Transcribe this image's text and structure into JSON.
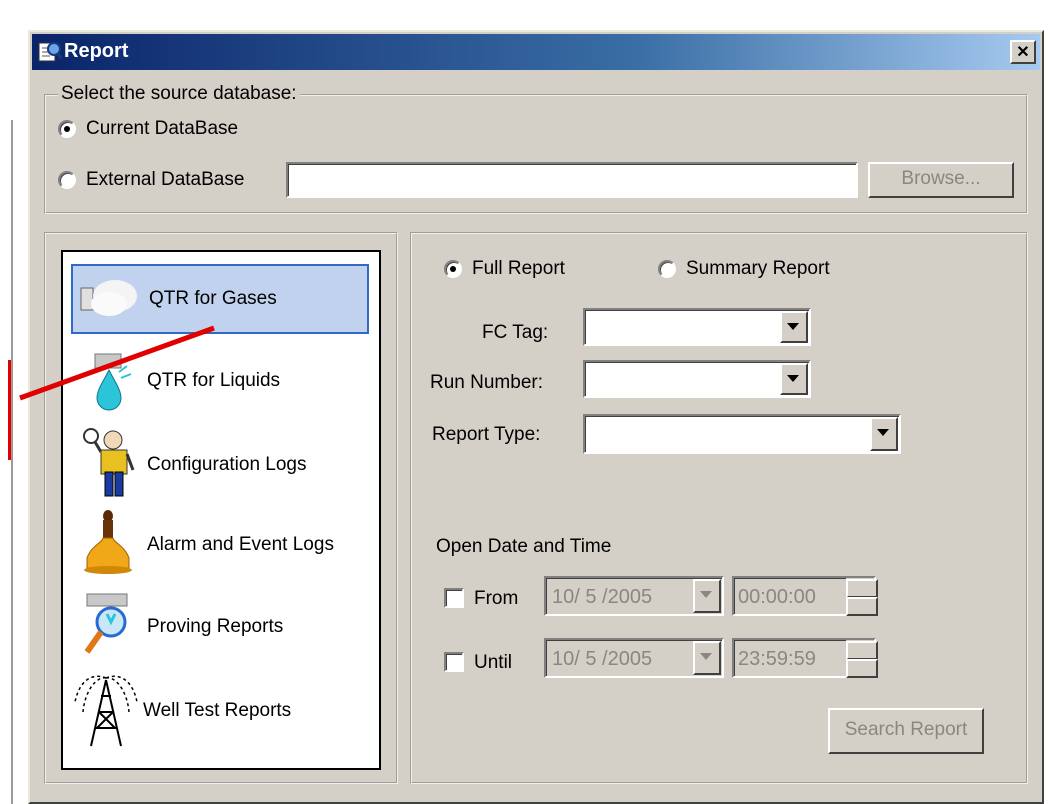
{
  "dialog": {
    "title": "Report",
    "close_label": "✕"
  },
  "source": {
    "group_label": "Select the source database:",
    "current_label": "Current DataBase",
    "external_label": "External DataBase",
    "external_path": "",
    "browse_label": "Browse...",
    "selected": "current"
  },
  "sidebar": {
    "items": [
      {
        "label": "QTR for Gases",
        "icon": "gas-icon",
        "selected": true
      },
      {
        "label": "QTR for Liquids",
        "icon": "liquid-drop-icon"
      },
      {
        "label": "Configuration Logs",
        "icon": "worker-icon"
      },
      {
        "label": "Alarm and Event Logs",
        "icon": "bell-icon"
      },
      {
        "label": "Proving Reports",
        "icon": "magnifier-icon"
      },
      {
        "label": "Well Test Reports",
        "icon": "oil-well-icon"
      }
    ]
  },
  "report": {
    "full_label": "Full Report",
    "summary_label": "Summary Report",
    "selected": "full",
    "fc_tag_label": "FC Tag:",
    "fc_tag_value": "",
    "run_number_label": "Run Number:",
    "run_number_value": "",
    "report_type_label": "Report Type:",
    "report_type_value": "",
    "date_group_label": "Open Date and Time",
    "from_label": "From",
    "from_date": "10/ 5 /2005",
    "from_time": "00:00:00",
    "until_label": "Until",
    "until_date": "10/ 5 /2005",
    "until_time": "23:59:59",
    "search_label": "Search Report"
  },
  "colors": {
    "dialog_bg": "#d4d0c8",
    "title_start": "#0a246a",
    "title_end": "#a6caf0",
    "selection": "#c1d2ee",
    "annotation_red": "#e00000"
  }
}
